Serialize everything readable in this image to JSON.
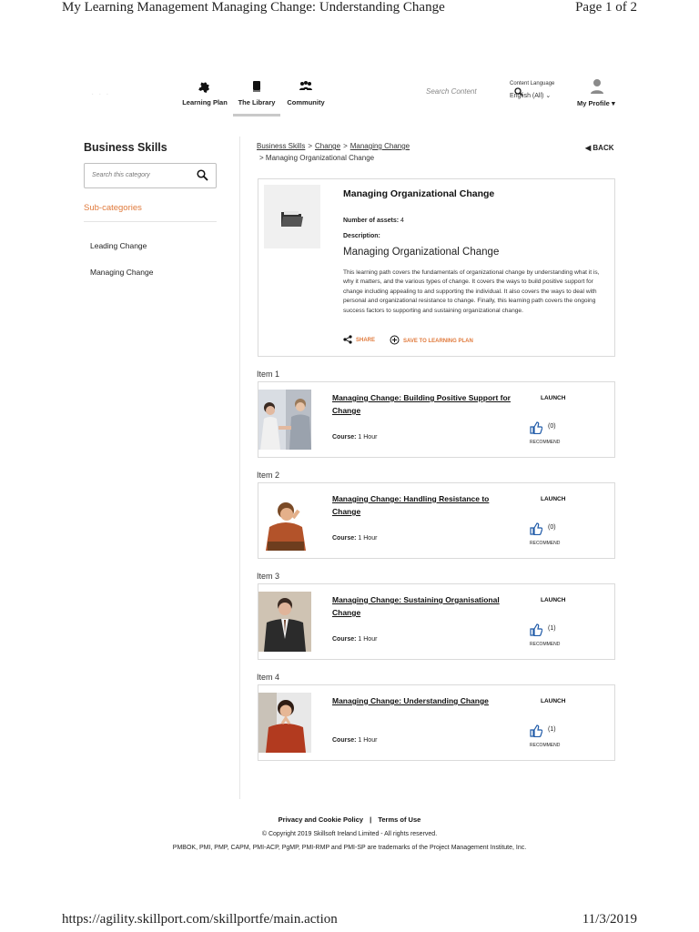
{
  "print_header": {
    "title": "My Learning Management Managing Change: Understanding Change",
    "page": "Page 1 of 2"
  },
  "print_footer": {
    "url": "https://agility.skillport.com/skillportfe/main.action",
    "date": "11/3/2019"
  },
  "nav": {
    "items": [
      {
        "label": "Learning Plan",
        "icon": "puzzle-icon"
      },
      {
        "label": "The Library",
        "icon": "book-icon"
      },
      {
        "label": "Community",
        "icon": "people-icon"
      }
    ],
    "search_placeholder": "Search Content",
    "content_language_label": "Content Language",
    "content_language_value": "English (All)",
    "profile_label": "My Profile"
  },
  "sidebar": {
    "title": "Business Skills",
    "search_placeholder": "Search this category",
    "subcategories_label": "Sub-categories",
    "items": [
      "Leading Change",
      "Managing Change"
    ]
  },
  "breadcrumb": {
    "links": [
      "Business Skills",
      "Change",
      "Managing Change"
    ],
    "current": "Managing Organizational Change",
    "back_label": "BACK"
  },
  "detail": {
    "title": "Managing Organizational Change",
    "assets_label": "Number of assets:",
    "assets_value": "4",
    "description_label": "Description:",
    "description_heading": "Managing Organizational Change",
    "description": "This learning path covers the fundamentals of organizational change by understanding what it is, why it matters, and the various types of change. It covers the ways to build positive support for change including appealing to and supporting the individual. It also covers the ways to deal with personal and organizational resistance to change. Finally, this learning path covers the ongoing success factors to supporting and sustaining organizational change.",
    "share_label": "SHARE",
    "save_label": "SAVE TO LEARNING PLAN",
    "accent_color": "#e07a3c"
  },
  "items": [
    {
      "label": "Item 1",
      "title": "Managing Change: Building Positive Support for Change",
      "course_label": "Course:",
      "duration": "1 Hour",
      "launch": "LAUNCH",
      "count": "(0)",
      "recommend": "RECOMMEND"
    },
    {
      "label": "Item 2",
      "title": "Managing Change: Handling Resistance to Change",
      "course_label": "Course:",
      "duration": "1 Hour",
      "launch": "LAUNCH",
      "count": "(0)",
      "recommend": "RECOMMEND"
    },
    {
      "label": "Item 3",
      "title": "Managing Change: Sustaining Organisational Change",
      "course_label": "Course:",
      "duration": "1 Hour",
      "launch": "LAUNCH",
      "count": "(1)",
      "recommend": "RECOMMEND"
    },
    {
      "label": "Item 4",
      "title": "Managing Change: Understanding Change",
      "course_label": "Course:",
      "duration": "1 Hour",
      "launch": "LAUNCH",
      "count": "(1)",
      "recommend": "RECOMMEND"
    }
  ],
  "footer": {
    "privacy": "Privacy and Cookie Policy",
    "separator": "|",
    "terms": "Terms of Use",
    "copyright": "© Copyright 2019 Skillsoft Ireland Limited - All rights reserved.",
    "trademarks": "PMBOK, PMI, PMP, CAPM, PMI-ACP, PgMP, PMI-RMP and PMI-SP are trademarks of the Project Management Institute, Inc."
  }
}
